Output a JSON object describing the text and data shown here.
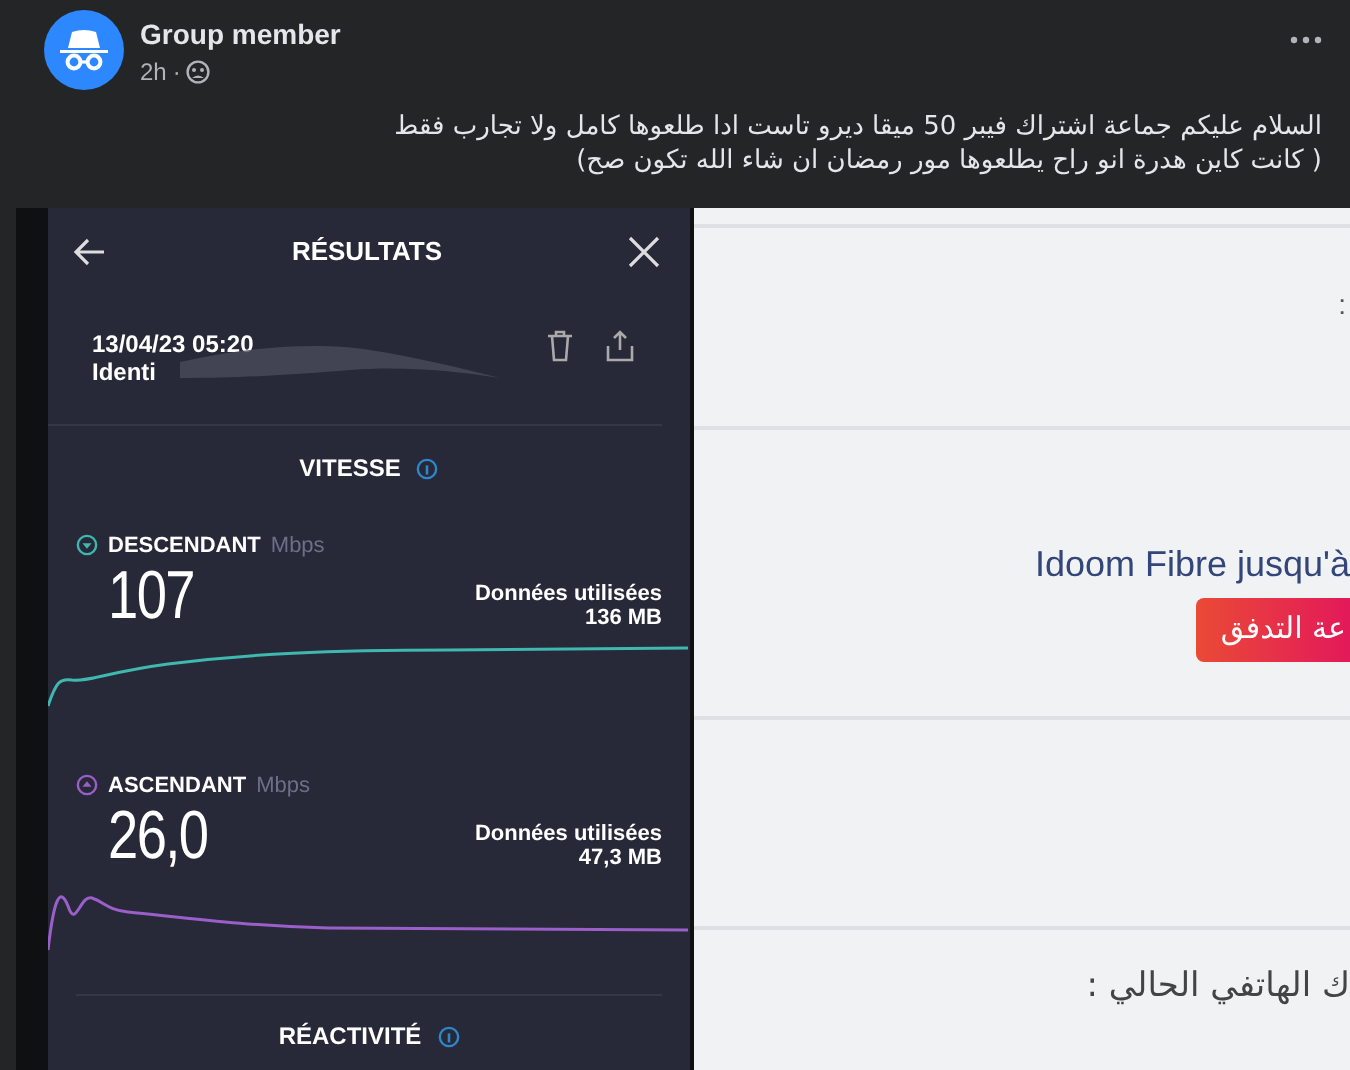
{
  "post": {
    "author": "Group member",
    "time": "2h",
    "separator": "·",
    "lines": [
      "السلام عليكم جماعة اشتراك فيبر  50 ميقا ديرو تاست ادا طلعوها كامل ولا تجارب فقط",
      "( كانت كاين هدرة انو راح يطلعوها مور رمضان ان شاء الله تكون صح)"
    ]
  },
  "speedtest": {
    "title": "RÉSULTATS",
    "date": "13/04/23 05:20",
    "identifier": "Identi",
    "speed_heading": "VITESSE",
    "metrics": [
      {
        "kind": "download",
        "label": "DESCENDANT",
        "unit": "Mbps",
        "value": "107",
        "data_label": "Données utilisées",
        "data_value": "136 MB"
      },
      {
        "kind": "upload",
        "label": "ASCENDANT",
        "unit": "Mbps",
        "value": "26,0",
        "data_label": "Données utilisées",
        "data_value": "47,3 MB"
      }
    ],
    "responsiveness_heading": "RÉACTIVITÉ"
  },
  "webpage": {
    "colon": ":",
    "headline": "Idoom Fibre jusqu'à",
    "button": "عة التدفق",
    "phone_label": "ك الهاتفي الحالي :"
  }
}
